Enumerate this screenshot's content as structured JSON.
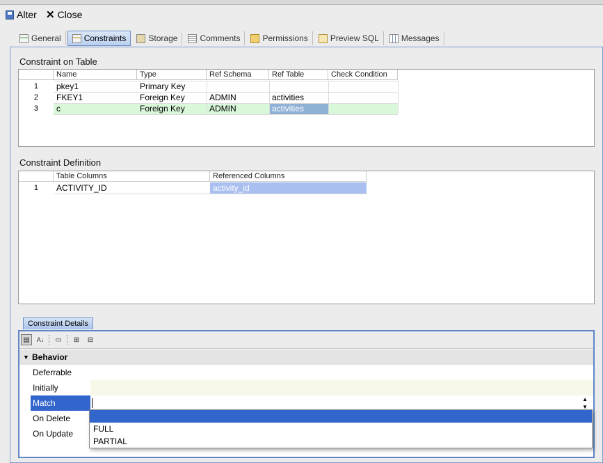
{
  "toolbar": {
    "alter_label": "Alter",
    "close_label": "Close"
  },
  "subtabs": [
    {
      "label": "General",
      "icon": "table-icon"
    },
    {
      "label": "Constraints",
      "icon": "constraint-icon",
      "active": true
    },
    {
      "label": "Storage",
      "icon": "storage-icon"
    },
    {
      "label": "Comments",
      "icon": "comments-icon"
    },
    {
      "label": "Permissions",
      "icon": "key-icon"
    },
    {
      "label": "Preview SQL",
      "icon": "sql-icon"
    },
    {
      "label": "Messages",
      "icon": "messages-icon"
    }
  ],
  "constraints": {
    "title": "Constraint on Table",
    "columns": [
      "Name",
      "Type",
      "Ref Schema",
      "Ref Table",
      "Check Condition"
    ],
    "rows": [
      {
        "num": "1",
        "name": "pkey1",
        "type": "Primary Key",
        "ref_schema": "",
        "ref_table": "",
        "check": ""
      },
      {
        "num": "2",
        "name": "FKEY1",
        "type": "Foreign Key",
        "ref_schema": "ADMIN",
        "ref_table": "activities",
        "check": ""
      },
      {
        "num": "3",
        "name": "c",
        "type": "Foreign Key",
        "ref_schema": "ADMIN",
        "ref_table": "activities",
        "check": ""
      }
    ]
  },
  "definition": {
    "title": "Constraint Definition",
    "columns": [
      "Table Columns",
      "Referenced Columns"
    ],
    "rows": [
      {
        "num": "1",
        "table_col": "ACTIVITY_ID",
        "ref_col": "activity_id"
      }
    ]
  },
  "details": {
    "tab_label": "Constraint Details",
    "group": "Behavior",
    "props": [
      {
        "name": "Deferrable",
        "value": ""
      },
      {
        "name": "Initially",
        "value": ""
      },
      {
        "name": "Match",
        "value": ""
      },
      {
        "name": "On Delete",
        "value": ""
      },
      {
        "name": "On Update",
        "value": ""
      }
    ],
    "match_options": [
      "",
      "FULL",
      "PARTIAL"
    ]
  },
  "colors": {
    "selected_blue": "#3366cc",
    "row_green": "#d9f7d9",
    "cell_highlight": "#8fb1d6",
    "ref_highlight": "#a9bff0",
    "panel_border": "#7b9ccf"
  }
}
